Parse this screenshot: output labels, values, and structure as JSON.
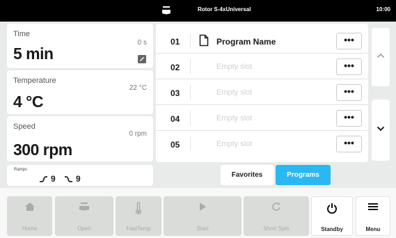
{
  "status_bar": {
    "rotor_icon": "rotor-icon",
    "rotor_name": "Rotor S-4xUniversal",
    "clock": "10:00"
  },
  "parameters": {
    "time": {
      "label": "Time",
      "current": "0 s",
      "value": "5 min",
      "icon": "edit-icon"
    },
    "temperature": {
      "label": "Temperature",
      "current": "22 °C",
      "value": "4 °C"
    },
    "speed": {
      "label": "Speed",
      "current": "0 rpm",
      "value": "300 rpm"
    }
  },
  "ramps": {
    "label": "Ramps",
    "up": "9",
    "down": "9",
    "up_icon": "ramp-up-icon",
    "down_icon": "ramp-down-icon"
  },
  "programs": [
    {
      "number": "01",
      "name": "Program Name",
      "empty": false
    },
    {
      "number": "02",
      "name": "Empty slot",
      "empty": true
    },
    {
      "number": "03",
      "name": "Empty slot",
      "empty": true
    },
    {
      "number": "04",
      "name": "Empty slot",
      "empty": true
    },
    {
      "number": "05",
      "name": "Empty slot",
      "empty": true
    }
  ],
  "more_label": "•••",
  "tabs": {
    "favorites": "Favorites",
    "programs": "Programs",
    "active": "programs"
  },
  "nav": {
    "home": "Home",
    "open": "Open",
    "fasttemp": "FastTemp",
    "start": "Start",
    "short_spin": "Short Spin",
    "standby": "Standby",
    "menu": "Menu"
  },
  "colors": {
    "accent": "#29b8f2",
    "background": "#e8ebe9",
    "status_bar": "#000000",
    "disabled_button": "#dadcda",
    "disabled_text": "#a8aba9"
  }
}
